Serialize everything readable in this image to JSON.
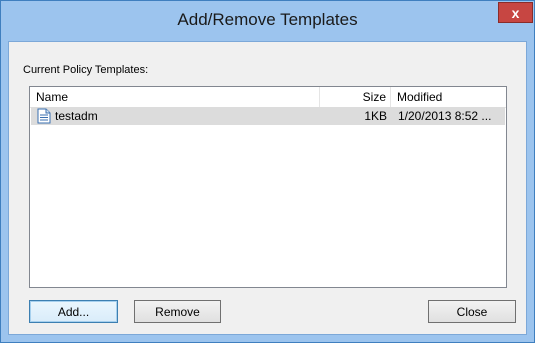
{
  "window": {
    "title": "Add/Remove Templates",
    "close_glyph": "x"
  },
  "section_label": "Current Policy Templates:",
  "list": {
    "columns": {
      "name": "Name",
      "size": "Size",
      "modified": "Modified"
    },
    "rows": [
      {
        "name": "testadm",
        "size": "1KB",
        "modified": "1/20/2013 8:52 ...",
        "icon": "file-icon"
      }
    ]
  },
  "buttons": {
    "add": "Add...",
    "remove": "Remove",
    "close": "Close"
  }
}
